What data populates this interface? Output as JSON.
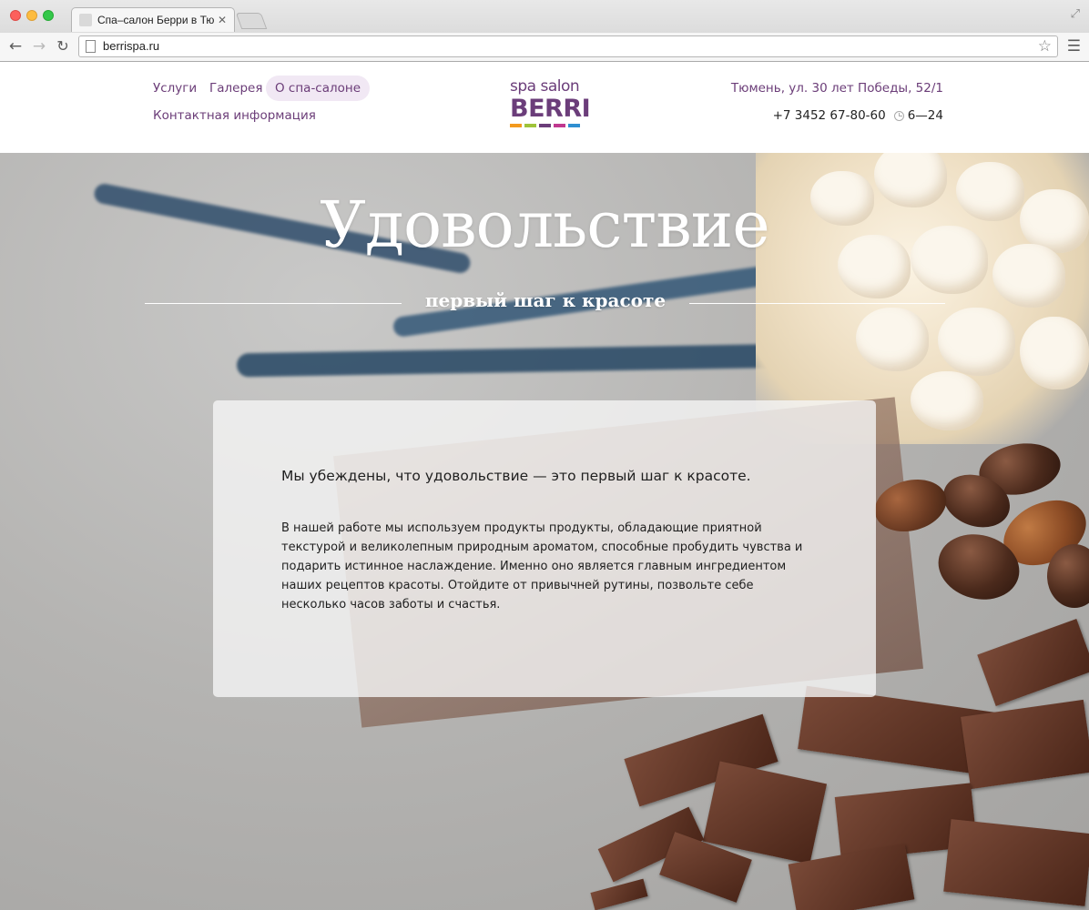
{
  "browser": {
    "tab_title": "Спа–салон Берри в Тюмени",
    "tab_close": "✕",
    "url": "berrispa.ru"
  },
  "nav": {
    "items": [
      {
        "label": "Услуги",
        "active": false
      },
      {
        "label": "Галерея",
        "active": false
      },
      {
        "label": "О спа-салоне",
        "active": true
      },
      {
        "label": "Контактная информация",
        "active": false
      }
    ]
  },
  "logo": {
    "line1": "spa salon",
    "line2": "BERRI",
    "bar_colors": [
      "#f39a1e",
      "#9fc33a",
      "#6b3d7a",
      "#c0388f",
      "#2f8fd1"
    ]
  },
  "contacts": {
    "address": "Тюмень, ул. 30 лет Победы, 52/1",
    "phone": "+7 3452 67-80-60",
    "hours": "6—24"
  },
  "hero": {
    "title": "Удовольствие",
    "subtitle": "первый шаг к красоте"
  },
  "about": {
    "lead": "Мы убеждены, что удовольствие — это первый шаг к красоте.",
    "body": "В нашей работе мы используем продукты продукты, обладающие приятной текстурой и великолепным природным ароматом, способные пробудить чувства и подарить истинное наслаждение. Именно оно является главным ингредиентом наших рецептов красоты. Отойдите от привычней рутины, позвольте себе несколько часов заботы и счастья."
  },
  "colors": {
    "brand_purple": "#6b3d78",
    "active_nav_bg": "#f1e8f4"
  }
}
